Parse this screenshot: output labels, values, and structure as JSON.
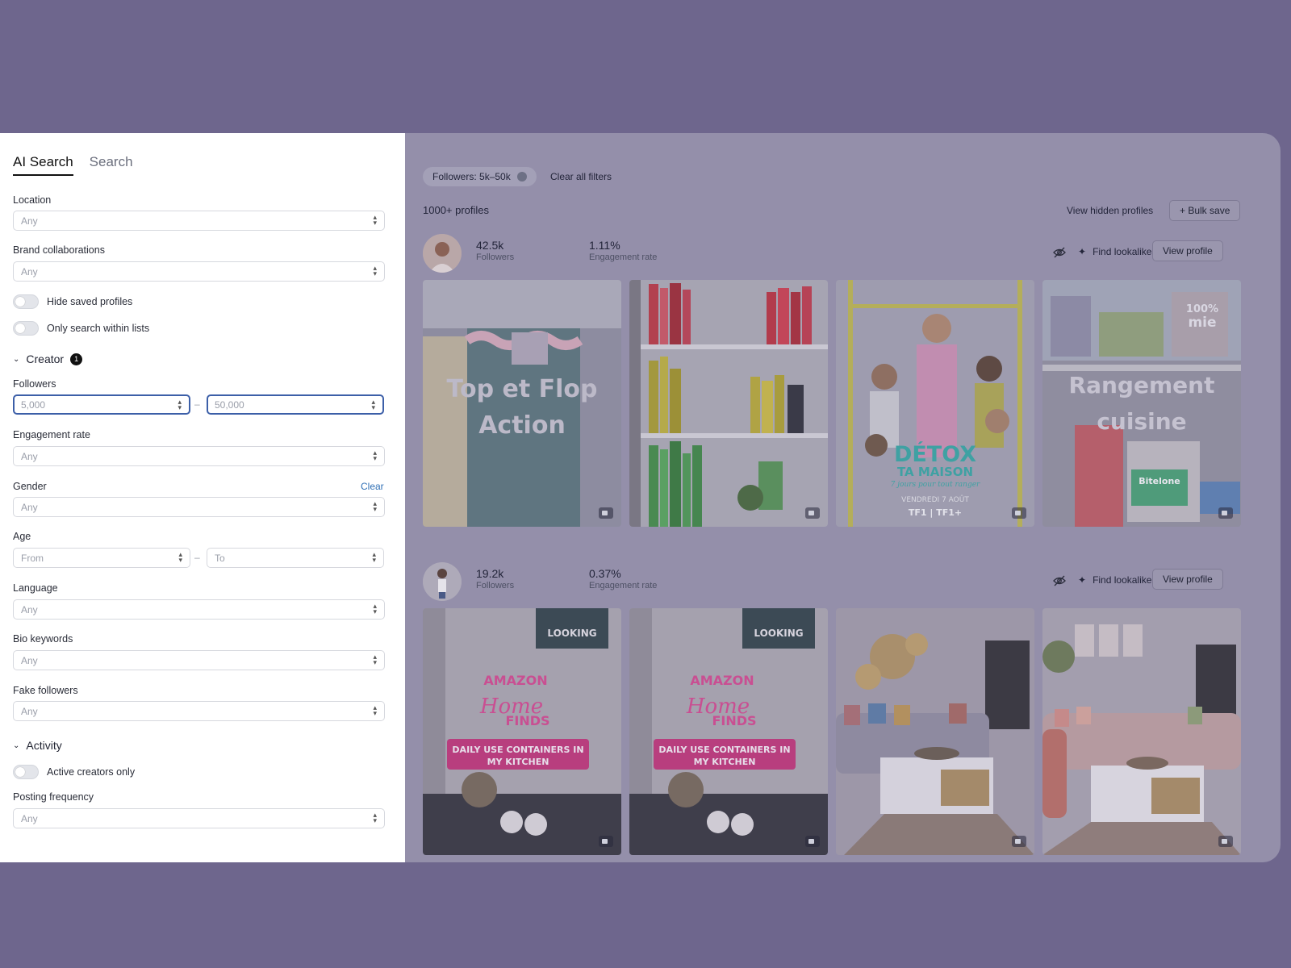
{
  "tabs": {
    "ai_search": "AI Search",
    "search": "Search"
  },
  "filters": {
    "location": {
      "label": "Location",
      "value": "Any"
    },
    "brand": {
      "label": "Brand collaborations",
      "value": "Any"
    },
    "hide_saved": "Hide saved profiles",
    "only_lists": "Only search within lists",
    "creator_section": {
      "title": "Creator",
      "badge": "1"
    },
    "followers": {
      "label": "Followers",
      "min": "5,000",
      "max": "50,000"
    },
    "engagement": {
      "label": "Engagement rate",
      "value": "Any"
    },
    "gender": {
      "label": "Gender",
      "value": "Any",
      "clear": "Clear"
    },
    "age": {
      "label": "Age",
      "from": "From",
      "to": "To"
    },
    "language": {
      "label": "Language",
      "value": "Any"
    },
    "bio": {
      "label": "Bio keywords",
      "value": "Any"
    },
    "fake": {
      "label": "Fake followers",
      "value": "Any"
    },
    "activity_section": {
      "title": "Activity"
    },
    "active_only": "Active creators only",
    "posting": {
      "label": "Posting frequency",
      "value": "Any"
    },
    "range_dash": "–"
  },
  "results": {
    "chip": "Followers: 5k–50k",
    "clear_all": "Clear all filters",
    "count": "1000+ profiles",
    "view_hidden": "View hidden profiles",
    "bulk_save": "+ Bulk save",
    "find_lookalikes": "Find lookalikes",
    "lookalike_icon": "✦",
    "view_profile": "View profile",
    "profiles": [
      {
        "followers": "42.5k",
        "followers_label": "Followers",
        "engagement": "1.11%",
        "engagement_label": "Engagement rate",
        "thumbs": [
          {
            "lines": [
              "Top et Flop",
              "Action"
            ]
          },
          {
            "lines": []
          },
          {
            "lines": [
              "DÉTOX",
              "TA MAISON",
              "7 jours pour tout ranger",
              "VENDREDI 7 AOÛT",
              "TF1 | TF1+"
            ]
          },
          {
            "lines": [
              "100%",
              "mie",
              "Rangement",
              "cuisine",
              "Bitelone"
            ]
          }
        ]
      },
      {
        "followers": "19.2k",
        "followers_label": "Followers",
        "engagement": "0.37%",
        "engagement_label": "Engagement rate",
        "thumbs": [
          {
            "lines": [
              "LOOKING",
              "AMAZON",
              "Home",
              "FINDS",
              "DAILY USE CONTAINERS IN",
              "MY KITCHEN"
            ]
          },
          {
            "lines": [
              "LOOKING",
              "AMAZON",
              "Home",
              "FINDS",
              "DAILY USE CONTAINERS IN",
              "MY KITCHEN"
            ]
          },
          {
            "lines": []
          },
          {
            "lines": []
          }
        ]
      }
    ]
  },
  "colors": {
    "accent": "#3c5fa8",
    "overlay": "#948faa",
    "background": "#6e668d",
    "link": "#2f6fb5"
  }
}
